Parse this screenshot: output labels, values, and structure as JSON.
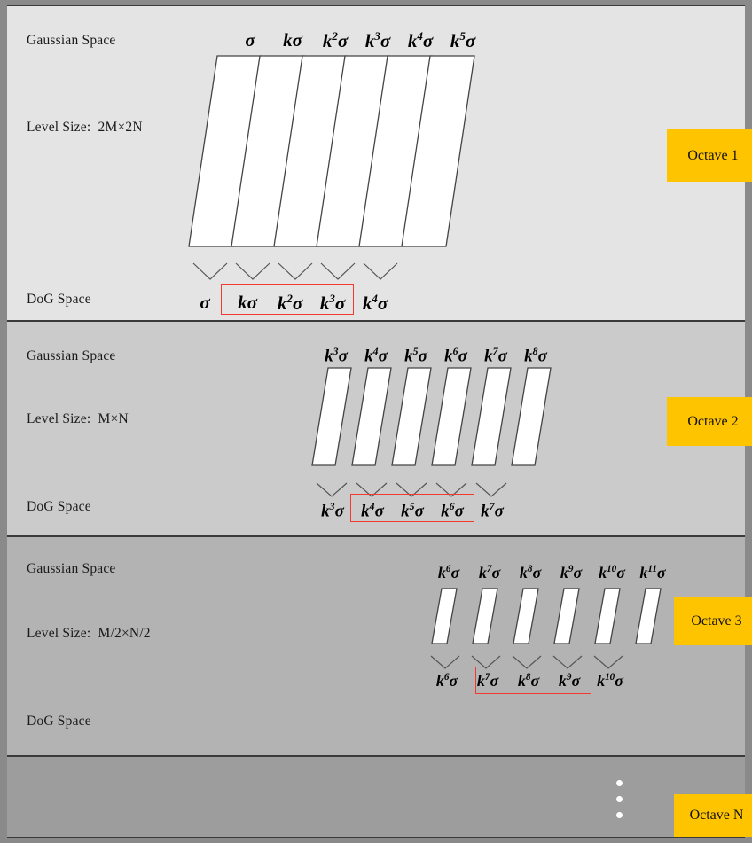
{
  "figure": {
    "title": "Gaussian scale-space / DoG pyramid",
    "background_color": "#8a8a8a",
    "accent_color": "#ffc400",
    "highlight_color": "#f4392f"
  },
  "octaves": [
    {
      "badge": "Octave 1",
      "gaussian_label": "Gaussian Space",
      "level_size_label": "Level Size:",
      "level_size_value": "2M×2N",
      "dog_label": "DoG Space",
      "band_color": "#e4e4e4",
      "gaussian_scales": [
        {
          "base": "σ",
          "exp": ""
        },
        {
          "base": "kσ",
          "exp": ""
        },
        {
          "base": "kσ",
          "exp": "2"
        },
        {
          "base": "kσ",
          "exp": "3"
        },
        {
          "base": "kσ",
          "exp": "4"
        },
        {
          "base": "kσ",
          "exp": "5"
        }
      ],
      "dog_scales": [
        {
          "base": "σ",
          "exp": ""
        },
        {
          "base": "kσ",
          "exp": ""
        },
        {
          "base": "kσ",
          "exp": "2"
        },
        {
          "base": "kσ",
          "exp": "3"
        },
        {
          "base": "kσ",
          "exp": "4"
        }
      ],
      "highlighted_dog_indices": [
        1,
        2,
        3
      ]
    },
    {
      "badge": "Octave 2",
      "gaussian_label": "Gaussian Space",
      "level_size_label": "Level Size:",
      "level_size_value": "M×N",
      "dog_label": "DoG Space",
      "band_color": "#cbcbcb",
      "gaussian_scales": [
        {
          "base": "kσ",
          "exp": "3"
        },
        {
          "base": "kσ",
          "exp": "4"
        },
        {
          "base": "kσ",
          "exp": "5"
        },
        {
          "base": "kσ",
          "exp": "6"
        },
        {
          "base": "kσ",
          "exp": "7"
        },
        {
          "base": "kσ",
          "exp": "8"
        }
      ],
      "dog_scales": [
        {
          "base": "kσ",
          "exp": "3"
        },
        {
          "base": "kσ",
          "exp": "4"
        },
        {
          "base": "kσ",
          "exp": "5"
        },
        {
          "base": "kσ",
          "exp": "6"
        },
        {
          "base": "kσ",
          "exp": "7"
        }
      ],
      "highlighted_dog_indices": [
        1,
        2,
        3
      ]
    },
    {
      "badge": "Octave 3",
      "gaussian_label": "Gaussian Space",
      "level_size_label": "Level Size:",
      "level_size_value": "M/2×N/2",
      "dog_label": "DoG Space",
      "band_color": "#b3b3b3",
      "gaussian_scales": [
        {
          "base": "kσ",
          "exp": "6"
        },
        {
          "base": "kσ",
          "exp": "7"
        },
        {
          "base": "kσ",
          "exp": "8"
        },
        {
          "base": "kσ",
          "exp": "9"
        },
        {
          "base": "kσ",
          "exp": "10"
        },
        {
          "base": "kσ",
          "exp": "11"
        }
      ],
      "dog_scales": [
        {
          "base": "kσ",
          "exp": "6"
        },
        {
          "base": "kσ",
          "exp": "7"
        },
        {
          "base": "kσ",
          "exp": "8"
        },
        {
          "base": "kσ",
          "exp": "9"
        },
        {
          "base": "kσ",
          "exp": "10"
        }
      ],
      "highlighted_dog_indices": [
        1,
        2,
        3
      ]
    },
    {
      "badge": "Octave N",
      "band_color": "#9d9d9d",
      "ellipsis": "⋮"
    }
  ]
}
